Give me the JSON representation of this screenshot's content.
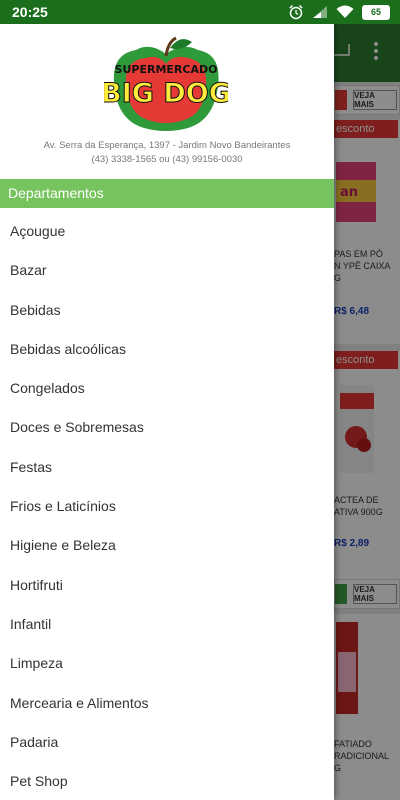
{
  "status_bar": {
    "time": "20:25",
    "battery": "65"
  },
  "store": {
    "logo_top": "SUPERMERCADO",
    "logo_main": "BIG DOG",
    "address": "Av. Serra da Esperança, 1397 - Jardim Novo Bandeirantes",
    "phones": "(43) 3338-1565 ou (43) 99156-0030"
  },
  "drawer": {
    "header": "Departamentos",
    "items": [
      "Açougue",
      "Bazar",
      "Bebidas",
      "Bebidas alcoólicas",
      "Congelados",
      "Doces e Sobremesas",
      "Festas",
      "Frios e Laticínios",
      "Higiene e Beleza",
      "Hortifruti",
      "Infantil",
      "Limpeza",
      "Mercearia e Alimentos",
      "Padaria",
      "Pet Shop"
    ]
  },
  "background": {
    "see_more": "VEJA MAIS",
    "discount_label": "esconto",
    "products": [
      {
        "line1": "PAS EM PÓ",
        "line2": "N YPÊ CAIXA",
        "line3": "G",
        "price": "R$ 6,48"
      },
      {
        "line1": "ACTEA DE",
        "line2": "ATIVA 900G",
        "line3": "",
        "price": "R$ 2,89"
      },
      {
        "line1": "FATIADO",
        "line2": "RADICIONAL",
        "line3": "G",
        "price": ""
      }
    ]
  },
  "colors": {
    "statusbar": "#1b6e1b",
    "dept_header": "#77c35d",
    "discount": "#e53935",
    "price": "#1a3ebf"
  }
}
